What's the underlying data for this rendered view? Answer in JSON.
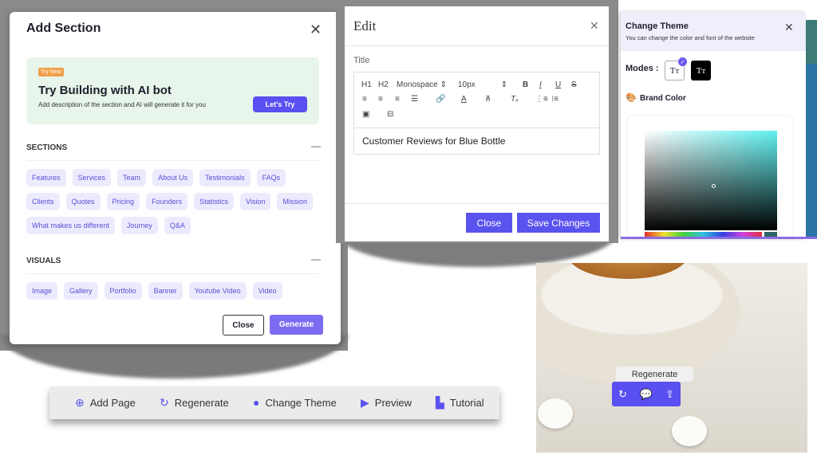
{
  "add_section": {
    "title": "Add Section",
    "banner": {
      "badge": "Try New",
      "title": "Try Building with AI bot",
      "description": "Add description of the section and AI will generate it for you",
      "button": "Let's Try"
    },
    "sections_heading": "SECTIONS",
    "sections": [
      "Features",
      "Services",
      "Team",
      "About Us",
      "Testimonials",
      "FAQs",
      "Clients",
      "Quotes",
      "Pricing",
      "Founders",
      "Statistics",
      "Vision",
      "Mission",
      "What makes us different",
      "Journey",
      "Q&A"
    ],
    "visuals_heading": "VISUALS",
    "visuals": [
      "Image",
      "Gallery",
      "Portfolio",
      "Banner",
      "Youtube Video",
      "Video"
    ],
    "close": "Close",
    "generate": "Generate"
  },
  "edit": {
    "title": "Edit",
    "field_label": "Title",
    "font": "Monospace",
    "size": "10px",
    "h1": "H1",
    "h2": "H2",
    "value": "Customer Reviews for Blue Bottle",
    "close": "Close",
    "save": "Save Changes"
  },
  "theme": {
    "title": "Change Theme",
    "subtitle": "You can change the color and font of the website",
    "modes_label": "Modes :",
    "mode_glyph": "Tт",
    "brand_color_label": "Brand Color",
    "selected_mode": "light",
    "brand_color": "#2f6466"
  },
  "toolbar": {
    "items": [
      {
        "label": "Add Page",
        "icon": "plus-circle-icon"
      },
      {
        "label": "Regenerate",
        "icon": "refresh-icon"
      },
      {
        "label": "Change Theme",
        "icon": "palette-icon"
      },
      {
        "label": "Preview",
        "icon": "play-circle-icon"
      },
      {
        "label": "Tutorial",
        "icon": "tutorial-icon"
      }
    ]
  },
  "floating": {
    "tooltip": "Regenerate"
  },
  "colors": {
    "accent": "#5a4ff0",
    "chip_bg": "#ecebfd",
    "banner_bg": "#e8f5ea"
  }
}
